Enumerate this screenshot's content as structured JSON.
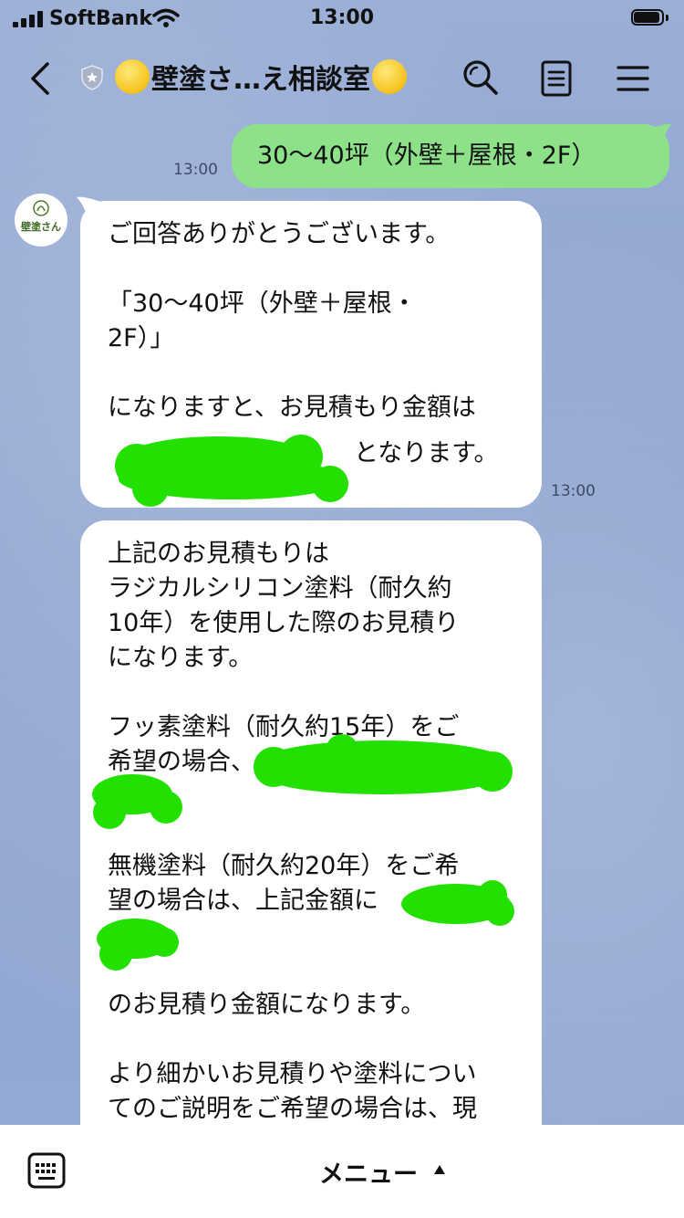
{
  "status_bar": {
    "carrier": "SoftBank",
    "time": "13:00"
  },
  "header": {
    "title": "壁塗さ…え相談室",
    "emoji": "yellow-circle-emoji"
  },
  "messages": [
    {
      "from": "me",
      "text": "30〜40坪（外壁＋屋根・2F）",
      "time": "13:00"
    },
    {
      "from": "shop",
      "time": "13:00",
      "lines": [
        "ご回答ありがとうございます。",
        "",
        "「30〜40坪（外壁＋屋根・",
        "2F）」",
        "",
        "になりますと、お見積もり金額は",
        "となります。"
      ]
    },
    {
      "from": "shop",
      "lines": [
        "上記のお見積もりは",
        "ラジカルシリコン塗料（耐久約",
        "10年）を使用した際のお見積り",
        "になります。",
        "",
        "フッ素塗料（耐久約15年）をご",
        "希望の場合、",
        "",
        "",
        "無機塗料（耐久約20年）をご希",
        "望の場合は、上記金額に",
        "",
        "",
        "のお見積り金額になります。",
        "",
        "より細かいお見積りや塗料につい",
        "てのご説明をご希望の場合は、現"
      ]
    }
  ],
  "avatar_label": "壁塗さん",
  "bottom_bar": {
    "menu_label": "メニュー"
  },
  "colors": {
    "background": "#8ea4cf",
    "sent_bubble": "#8de189",
    "redaction": "#22e000"
  }
}
